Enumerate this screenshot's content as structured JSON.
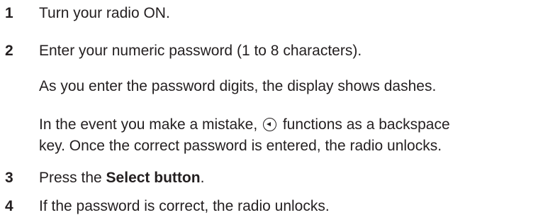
{
  "steps": [
    {
      "number": "1",
      "text": "Turn your radio ON."
    },
    {
      "number": "2",
      "text": "Enter your numeric password (1 to 8 characters)."
    },
    {
      "number": "3",
      "text_before": "Press the ",
      "text_bold": "Select button",
      "text_after": "."
    },
    {
      "number": "4",
      "text": "If the password is correct, the radio unlocks."
    }
  ],
  "step2_notes": {
    "dashes": "As you enter the password digits, the display shows dashes.",
    "mistake_before": "In the event you make a mistake, ",
    "icon": "left-arrow-icon",
    "mistake_after": " functions as a backspace",
    "mistake_line2": "key. Once the correct password is entered, the radio unlocks."
  }
}
